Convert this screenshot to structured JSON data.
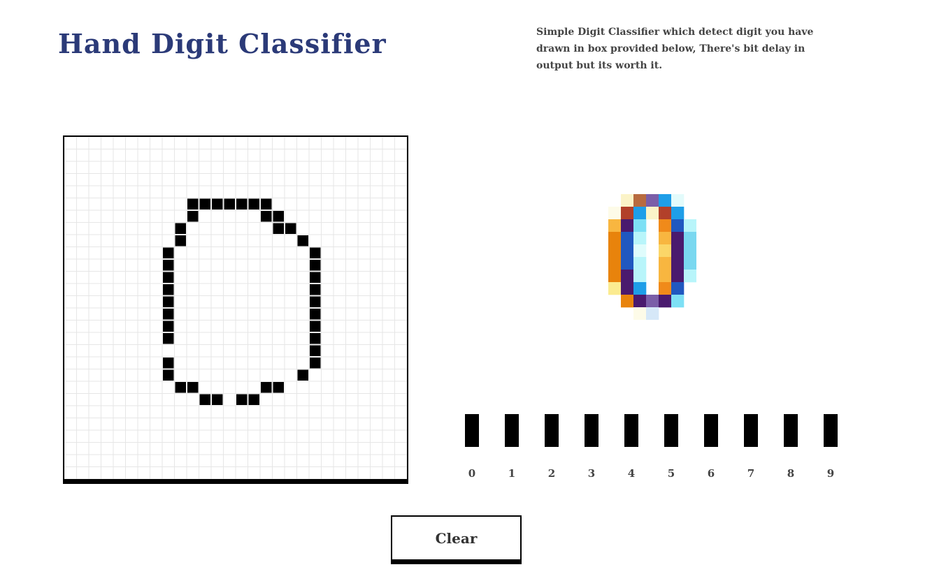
{
  "header": {
    "title": "Hand Digit Classifier",
    "description": "Simple Digit Classifier which detect digit you have drawn in box provided below, There's bit delay in output but its worth it."
  },
  "canvas": {
    "grid_size": 28,
    "grid_color": "#e6e6e6",
    "ink_color": "#000000",
    "drawn_cells": [
      [
        10,
        5
      ],
      [
        11,
        5
      ],
      [
        12,
        5
      ],
      [
        13,
        5
      ],
      [
        14,
        5
      ],
      [
        15,
        5
      ],
      [
        16,
        5
      ],
      [
        10,
        6
      ],
      [
        16,
        6
      ],
      [
        17,
        6
      ],
      [
        9,
        7
      ],
      [
        17,
        7
      ],
      [
        18,
        7
      ],
      [
        9,
        8
      ],
      [
        19,
        8
      ],
      [
        8,
        9
      ],
      [
        20,
        9
      ],
      [
        8,
        10
      ],
      [
        20,
        10
      ],
      [
        8,
        11
      ],
      [
        20,
        11
      ],
      [
        8,
        12
      ],
      [
        20,
        12
      ],
      [
        8,
        13
      ],
      [
        20,
        13
      ],
      [
        8,
        14
      ],
      [
        20,
        14
      ],
      [
        8,
        15
      ],
      [
        20,
        15
      ],
      [
        8,
        16
      ],
      [
        20,
        16
      ],
      [
        20,
        17
      ],
      [
        8,
        18
      ],
      [
        20,
        18
      ],
      [
        8,
        19
      ],
      [
        19,
        19
      ],
      [
        9,
        20
      ],
      [
        10,
        20
      ],
      [
        16,
        20
      ],
      [
        17,
        20
      ],
      [
        11,
        21
      ],
      [
        12,
        21
      ],
      [
        14,
        21
      ],
      [
        15,
        21
      ]
    ]
  },
  "preview": {
    "cols": 7,
    "rows": 10,
    "pixels": [
      [
        "",
        "#fbf3c8",
        "#b86b3f",
        "#7b5ea8",
        "#1e9ee8",
        "#e3fbfb",
        ""
      ],
      [
        "#fdfbe8",
        "#b2402a",
        "#1e9ee8",
        "#fbf3c8",
        "#b2402a",
        "#1e9ee8",
        ""
      ],
      [
        "#f8b640",
        "#4a1a6e",
        "#7de0f5",
        "",
        "#f08a1a",
        "#2058c0",
        "#b8f5fa"
      ],
      [
        "#e8830c",
        "#2058c0",
        "#b8f5fa",
        "",
        "#f8b640",
        "#4a1a6e",
        "#7ad8f0"
      ],
      [
        "#e8830c",
        "#2058c0",
        "#dffcfc",
        "",
        "#fbd668",
        "#4a1a6e",
        "#7ad8f0"
      ],
      [
        "#e8830c",
        "#2058c0",
        "#b8f5fa",
        "",
        "#f8b640",
        "#4a1a6e",
        "#7ad8f0"
      ],
      [
        "#e8830c",
        "#4a1a6e",
        "#b8f5fa",
        "",
        "#f8b640",
        "#4a1a6e",
        "#b8f5fa"
      ],
      [
        "#fbeb90",
        "#4a1a6e",
        "#1e9ee8",
        "",
        "#f08a1a",
        "#2058c0",
        ""
      ],
      [
        "",
        "#e8830c",
        "#4a1a6e",
        "#7b5ea8",
        "#4a1a6e",
        "#7de0f5",
        ""
      ],
      [
        "",
        "",
        "#fdfbe8",
        "#d6e8f8",
        "",
        "",
        ""
      ]
    ]
  },
  "prediction": {
    "labels": [
      "0",
      "1",
      "2",
      "3",
      "4",
      "5",
      "6",
      "7",
      "8",
      "9"
    ],
    "probabilities": [
      0,
      0,
      0,
      0,
      0,
      0,
      0,
      0,
      0,
      0
    ],
    "bar_color": "#000000"
  },
  "actions": {
    "clear_label": "Clear"
  }
}
